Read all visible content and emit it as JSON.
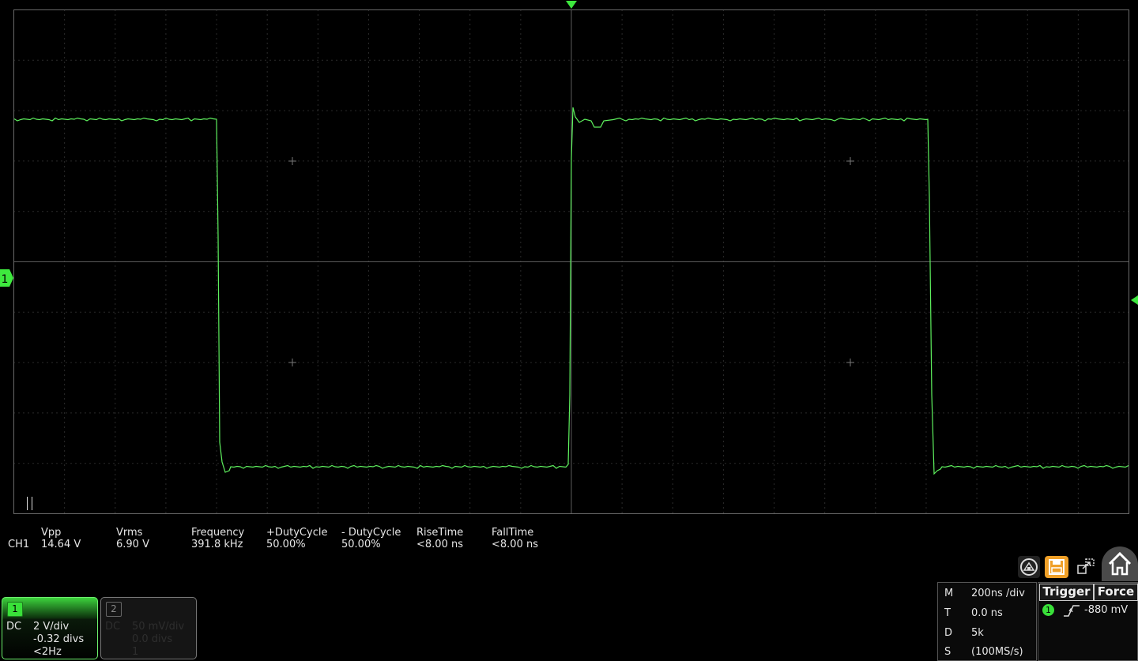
{
  "channel_marker": "1",
  "waveform_color": "#5ef05e",
  "measurements": {
    "row_label": "CH1",
    "items": [
      {
        "name": "Vpp",
        "value": "14.64 V"
      },
      {
        "name": "Vrms",
        "value": "6.90 V"
      },
      {
        "name": "Frequency",
        "value": "391.8 kHz"
      },
      {
        "name": "+DutyCycle",
        "value": "50.00%"
      },
      {
        "name": "- DutyCycle",
        "value": "50.00%"
      },
      {
        "name": "RiseTime",
        "value": "<8.00 ns"
      },
      {
        "name": "FallTime",
        "value": "<8.00 ns"
      }
    ]
  },
  "ch1": {
    "badge": "1",
    "coupling": "DC",
    "scale": "2 V/div",
    "offset": "-0.32 divs",
    "bw": "<2Hz"
  },
  "ch2": {
    "badge": "2",
    "coupling": "DC",
    "scale": "50 mV/div",
    "offset": "0.0 divs",
    "extra": "1"
  },
  "timebase": {
    "m_label": "M",
    "m_value": "200ns /div",
    "t_label": "T",
    "t_value": "0.0 ns",
    "d_label": "D",
    "d_value": "5k",
    "s_label": "S",
    "s_value": "(100MS/s)"
  },
  "trigger": {
    "button": "Trigger",
    "force": "Force",
    "source": "1",
    "level": "-880 mV"
  },
  "icons": [
    "auto-scale-icon",
    "save-icon",
    "zoom-fit-icon",
    "home-icon"
  ]
}
